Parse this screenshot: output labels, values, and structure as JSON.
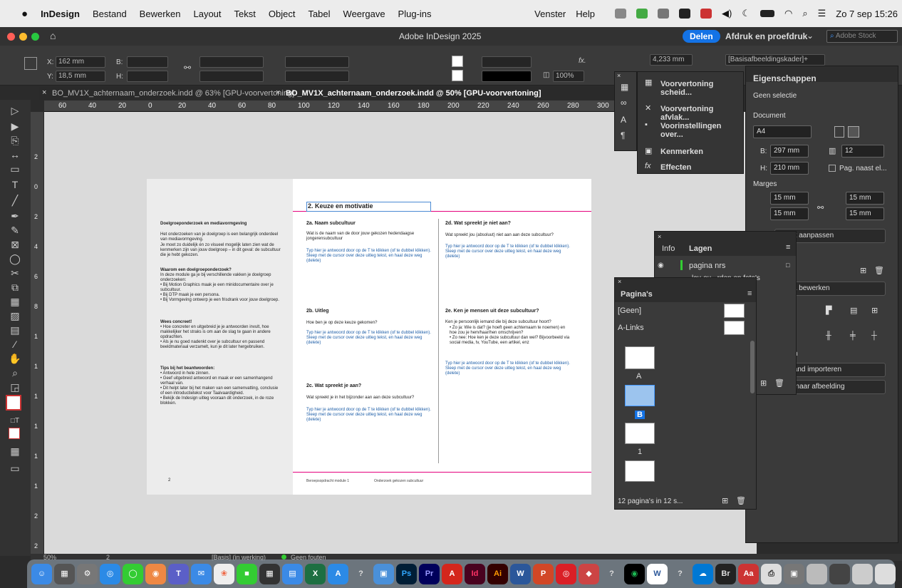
{
  "menubar": {
    "apple": "",
    "app": "InDesign",
    "items": [
      "Bestand",
      "Bewerken",
      "Layout",
      "Tekst",
      "Object",
      "Tabel",
      "Weergave",
      "Plug-ins"
    ],
    "right_items": [
      "Venster",
      "Help"
    ],
    "datetime": "Zo 7 sep 15:26"
  },
  "titlebar": {
    "title": "Adobe InDesign 2025",
    "share": "Delen",
    "workspace": "Afdruk en proefdruk",
    "search_placeholder": "Adobe Stock"
  },
  "ctrl": {
    "x_label": "X:",
    "x": "162 mm",
    "y_label": "Y:",
    "y": "18,5 mm",
    "b_label": "B:",
    "h_label": "H:",
    "zoom": "100%",
    "fx": "fx.",
    "stroke": "4,233 mm",
    "frame": "[Basisafbeeldingskader]+"
  },
  "tabs": [
    {
      "label": "BO_MV1X_achternaam_onderzoek.indd @ 63% [GPU-voorvertoning]",
      "active": false
    },
    {
      "label": "BO_MV1X_achternaam_onderzoek.indd @ 50% [GPU-voorvertoning]",
      "active": true
    }
  ],
  "ruler": [
    "60",
    "40",
    "20",
    "0",
    "20",
    "40",
    "60",
    "80",
    "100",
    "120",
    "140",
    "160",
    "180",
    "200",
    "220",
    "240",
    "260",
    "280",
    "300"
  ],
  "vruler": [
    "2",
    "0",
    "2",
    "4",
    "6",
    "8",
    "1",
    "1",
    "1",
    "1",
    "1",
    "1",
    "2",
    "2"
  ],
  "left_page": {
    "h1": "Doelgroeponderzoek en mediavormgeving",
    "p1": "Het onderzoeken van je doelgroep is een belangrijk onderdeel van mediavormgeving.",
    "p2": "Je moet zo duidelijk én zo visueel mogelijk laten zien wat de kenmerken zijn van jouw doelgroep – in dit geval: de subcultuur die je hebt gekozen.",
    "h2": "Waarom een doelgroeponderzoek?",
    "p3": "In deze module ga je bij verschillende vakken je doelgroep onderzoeken:",
    "l1": [
      "Bij Motion Graphics maak je een minidocumentaire over je subcultuur.",
      "Bij DTP maak je een persona.",
      "Bij Vormgeving ontwerp je een frisdrank voor jouw doelgroep."
    ],
    "h3": "Wees concreet!",
    "l2": [
      "Hoe concreter en uitgebreid je je antwoorden invult, hoe makkelijker het straks is om aan de slag te gaan in andere opdrachten.",
      "Als je nu goed nadenkt over je subcultuur en passend beeldmateriaal verzamelt, kun je dit later hergebruiken."
    ],
    "h4": "Tips bij het beantwoorden:",
    "l3": [
      "Antwoord in hele zinnen.",
      "Geef uitgebreid antwoord en maak er een samenhangend verhaal van.",
      "Dit helpt later bij het maken van een samenvatting, conclusie of een introductietekst voor Taalvaardigheid.",
      "Bekijk de Indesign uitleg vooraan dit onderzoek, in de roze blokken."
    ],
    "page_no": "2"
  },
  "right_page": {
    "title": "2. Keuze en motivatie",
    "s2a": "2a. Naam subcultuur",
    "q2a": "Wat is de naam van de door jouw gekozen hedendaagse jongerensubcultuur",
    "hint": "Typ hier je antwoord door op de T te klikken (of te dubbel klikken). Sleep met de cursor over deze uitleg tekst, en haal deze weg (delete)",
    "s2b": "2b. Uitleg",
    "q2b": "Hoe ben je op deze keuze gekomen?",
    "s2c": "2c. Wat spreekt je aan?",
    "q2c": "Wat spreekt je in het bijzonder aan aan deze subcultuur?",
    "s2d": "2d. Wat spreekt je niet aan?",
    "q2d": "Wat spreekt jou (absoluut) niet aan aan deze subcultuur?",
    "s2e": "2e. Ken je mensen uit deze subcultuur?",
    "q2e": "Ken je persoonlijk iemand die bij deze subcultuur hoort?",
    "l2e": [
      "Zo ja: Wie is dat? (je hoeft geen achternaam te noemen) en hoe zou je hem/haar/hen omschrijven?",
      "Zo nee: Hoe ken je deze subcultuur dan wel? Bijvoorbeeld via social media, tv, YouTube, een artikel, enz"
    ],
    "footer1": "Beroepsopdracht module 1",
    "footer2": "Onderzoek gekozen subcultuur"
  },
  "flyout": {
    "items": [
      "Voorvertoning scheid...",
      "Voorvertoning afvlak...",
      "Voorinstellingen over...",
      "Kenmerken",
      "Effecten"
    ]
  },
  "props": {
    "tab": "Eigenschappen",
    "nosel": "Geen selectie",
    "doc": "Document",
    "size": "A4",
    "b_label": "B:",
    "b": "297 mm",
    "h_label": "H:",
    "h": "210 mm",
    "pages": "12",
    "facing": "Pag. naast el...",
    "margins": "Marges",
    "m1": "15 mm",
    "m2": "15 mm",
    "m3": "15 mm",
    "m4": "15 mm",
    "layout_btn": "ayout aanpassen",
    "pagina_btn": "agina bewerken",
    "ers": "ers",
    "gen": "gen",
    "import_btn": "stand importeren",
    "img_btn": "st naar afbeelding"
  },
  "layers": {
    "tab_info": "Info",
    "tab": "Lagen",
    "l1": "pagina nrs",
    "l2": "lay-ou...rden en foto's"
  },
  "pages": {
    "tab": "Pagina's",
    "none": "[Geen]",
    "alinks": "A-Links",
    "labels": [
      "A",
      "B",
      "1"
    ],
    "footer": "12 pagina's in 12 s..."
  },
  "status": {
    "zoom": "50%",
    "page": "2",
    "mode": "[Basis] (in werking)",
    "errors": "Geen fouten"
  },
  "dock": [
    "Finder",
    "Launchpad",
    "Safari",
    "Chrome",
    "Berichten",
    "Chrome",
    "Teams",
    "Mail",
    "Foto's",
    "FaceTime",
    "Calculator",
    "Files",
    "Excel",
    "App Store",
    "?",
    "Preview",
    "Photoshop",
    "Premiere",
    "Acrobat",
    "InDesign",
    "Illustrator",
    "Word",
    "PowerPoint",
    "Creative Cloud",
    "Affinity",
    "?",
    "Spotify",
    "Word",
    "?",
    "OneDrive",
    "Bridge",
    "Aa",
    "Print",
    "Screenshot",
    "Image",
    "Image",
    "Image",
    "Image",
    "Trash"
  ]
}
